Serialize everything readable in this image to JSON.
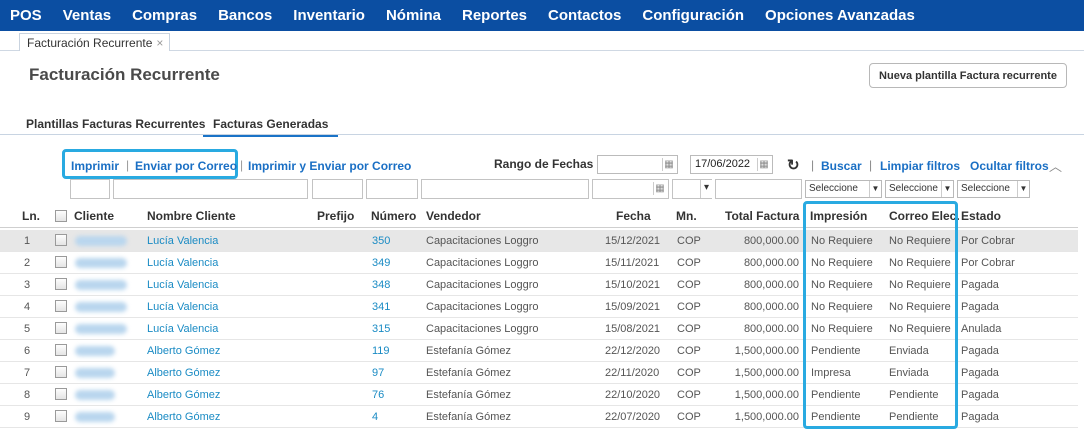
{
  "nav": [
    "POS",
    "Ventas",
    "Compras",
    "Bancos",
    "Inventario",
    "Nómina",
    "Reportes",
    "Contactos",
    "Configuración",
    "Opciones Avanzadas"
  ],
  "doc_tab": {
    "label": "Facturación Recurrente",
    "close": "×"
  },
  "page_title": "Facturación Recurrente",
  "new_template_button": "Nueva plantilla Factura recurrente",
  "subtabs": {
    "templates": "Plantillas Facturas Recurrentes",
    "generated": "Facturas Generadas"
  },
  "actions": {
    "print": "Imprimir",
    "sep": "|",
    "send_mail": "Enviar por Correo",
    "print_send": "Imprimir y Enviar por Correo"
  },
  "filters": {
    "range_label": "Rango de Fechas",
    "date_from": "",
    "date_to": "17/06/2022",
    "search": "Buscar",
    "clear": "Limpiar filtros",
    "hide": "Ocultar filtros",
    "select_placeholder": "Seleccione"
  },
  "columns": {
    "ln": "Ln.",
    "client": "Cliente",
    "client_name": "Nombre Cliente",
    "prefix": "Prefijo",
    "number": "Número",
    "seller": "Vendedor",
    "date": "Fecha",
    "currency": "Mn.",
    "total": "Total Factura",
    "printing": "Impresión",
    "email": "Correo Elec.",
    "status": "Estado"
  },
  "rows": [
    {
      "ln": "1",
      "name": "Lucía Valencia",
      "number": "350",
      "seller": "Capacitaciones Loggro",
      "date": "15/12/2021",
      "currency": "COP",
      "total": "800,000.00",
      "printing": "No Requiere",
      "email": "No Requiere",
      "status": "Por Cobrar"
    },
    {
      "ln": "2",
      "name": "Lucía Valencia",
      "number": "349",
      "seller": "Capacitaciones Loggro",
      "date": "15/11/2021",
      "currency": "COP",
      "total": "800,000.00",
      "printing": "No Requiere",
      "email": "No Requiere",
      "status": "Por Cobrar"
    },
    {
      "ln": "3",
      "name": "Lucía Valencia",
      "number": "348",
      "seller": "Capacitaciones Loggro",
      "date": "15/10/2021",
      "currency": "COP",
      "total": "800,000.00",
      "printing": "No Requiere",
      "email": "No Requiere",
      "status": "Pagada"
    },
    {
      "ln": "4",
      "name": "Lucía Valencia",
      "number": "341",
      "seller": "Capacitaciones Loggro",
      "date": "15/09/2021",
      "currency": "COP",
      "total": "800,000.00",
      "printing": "No Requiere",
      "email": "No Requiere",
      "status": "Pagada"
    },
    {
      "ln": "5",
      "name": "Lucía Valencia",
      "number": "315",
      "seller": "Capacitaciones Loggro",
      "date": "15/08/2021",
      "currency": "COP",
      "total": "800,000.00",
      "printing": "No Requiere",
      "email": "No Requiere",
      "status": "Anulada"
    },
    {
      "ln": "6",
      "name": "Alberto Gómez",
      "number": "119",
      "seller": "Estefanía Gómez",
      "date": "22/12/2020",
      "currency": "COP",
      "total": "1,500,000.00",
      "printing": "Pendiente",
      "email": "Enviada",
      "status": "Pagada"
    },
    {
      "ln": "7",
      "name": "Alberto Gómez",
      "number": "97",
      "seller": "Estefanía Gómez",
      "date": "22/11/2020",
      "currency": "COP",
      "total": "1,500,000.00",
      "printing": "Impresa",
      "email": "Enviada",
      "status": "Pagada"
    },
    {
      "ln": "8",
      "name": "Alberto Gómez",
      "number": "76",
      "seller": "Estefanía Gómez",
      "date": "22/10/2020",
      "currency": "COP",
      "total": "1,500,000.00",
      "printing": "Pendiente",
      "email": "Pendiente",
      "status": "Pagada"
    },
    {
      "ln": "9",
      "name": "Alberto Gómez",
      "number": "4",
      "seller": "Estefanía Gómez",
      "date": "22/07/2020",
      "currency": "COP",
      "total": "1,500,000.00",
      "printing": "Pendiente",
      "email": "Pendiente",
      "status": "Pagada"
    }
  ],
  "colors": {
    "nav_bg": "#0b4ea2",
    "link": "#1a6fc4",
    "highlight": "#29aae1"
  }
}
